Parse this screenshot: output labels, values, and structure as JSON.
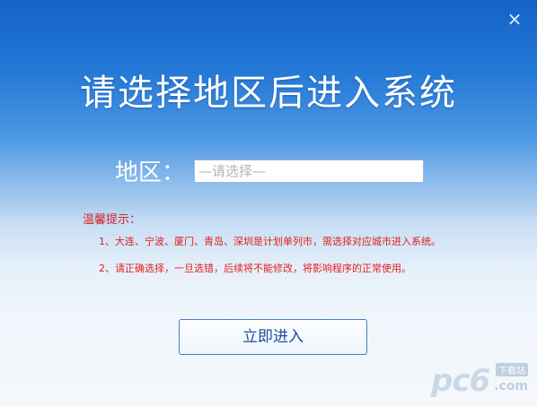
{
  "window": {
    "close_icon": "×"
  },
  "title": "请选择地区后进入系统",
  "region": {
    "label": "地区：",
    "selected": "—请选择—"
  },
  "tips": {
    "title": "温馨提示：",
    "items": [
      "1、大连、宁波、厦门、青岛、深圳是计划单列市，需选择对应城市进入系统。",
      "2、请正确选择，一旦选错，后续将不能修改，将影响程序的正常使用。"
    ]
  },
  "actions": {
    "enter_label": "立即进入"
  },
  "watermark": {
    "main": "pc6",
    "cn": "下载站",
    "com": ".com"
  },
  "colors": {
    "title": "#ffffff",
    "tip_text": "#e02020",
    "button_border": "#4b7ec0",
    "button_text": "#1e4f9a"
  }
}
